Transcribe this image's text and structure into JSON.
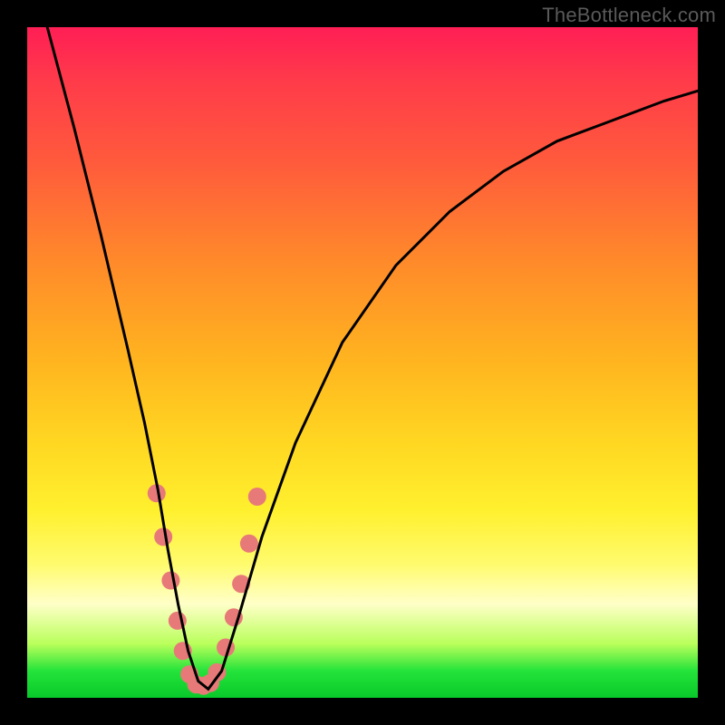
{
  "watermark": "TheBottleneck.com",
  "chart_data": {
    "type": "line",
    "title": "",
    "xlabel": "",
    "ylabel": "",
    "xlim": [
      0,
      100
    ],
    "ylim": [
      0,
      100
    ],
    "series": [
      {
        "name": "curve",
        "x": [
          3,
          7,
          11,
          15,
          17.5,
          19.5,
          21,
          22.5,
          24,
          25.5,
          27,
          29,
          31.5,
          35,
          40,
          47,
          55,
          63,
          71,
          79,
          87,
          95,
          100
        ],
        "values": [
          100,
          85,
          69,
          52,
          41,
          31,
          22,
          14,
          7,
          2.5,
          1.3,
          4,
          12,
          24,
          38,
          53,
          64.5,
          72.5,
          78.5,
          83,
          86,
          89,
          90.5
        ]
      }
    ],
    "markers": {
      "comment": "salmon circular markers scattered along both limbs of the V near the bottom",
      "color": "#e77a78",
      "radius_px": 10,
      "points_xy": [
        [
          19.3,
          30.5
        ],
        [
          20.3,
          24.0
        ],
        [
          21.4,
          17.5
        ],
        [
          22.4,
          11.5
        ],
        [
          23.2,
          7.0
        ],
        [
          24.2,
          3.5
        ],
        [
          25.2,
          2.0
        ],
        [
          26.3,
          1.8
        ],
        [
          27.3,
          2.2
        ],
        [
          28.3,
          3.8
        ],
        [
          29.6,
          7.5
        ],
        [
          30.8,
          12.0
        ],
        [
          31.9,
          17.0
        ],
        [
          33.1,
          23.0
        ],
        [
          34.3,
          30.0
        ]
      ]
    },
    "gradient_stops": [
      {
        "pos": 0,
        "color": "#ff1e55"
      },
      {
        "pos": 50,
        "color": "#ffb51f"
      },
      {
        "pos": 80,
        "color": "#fffb6d"
      },
      {
        "pos": 100,
        "color": "#08c92a"
      }
    ]
  }
}
